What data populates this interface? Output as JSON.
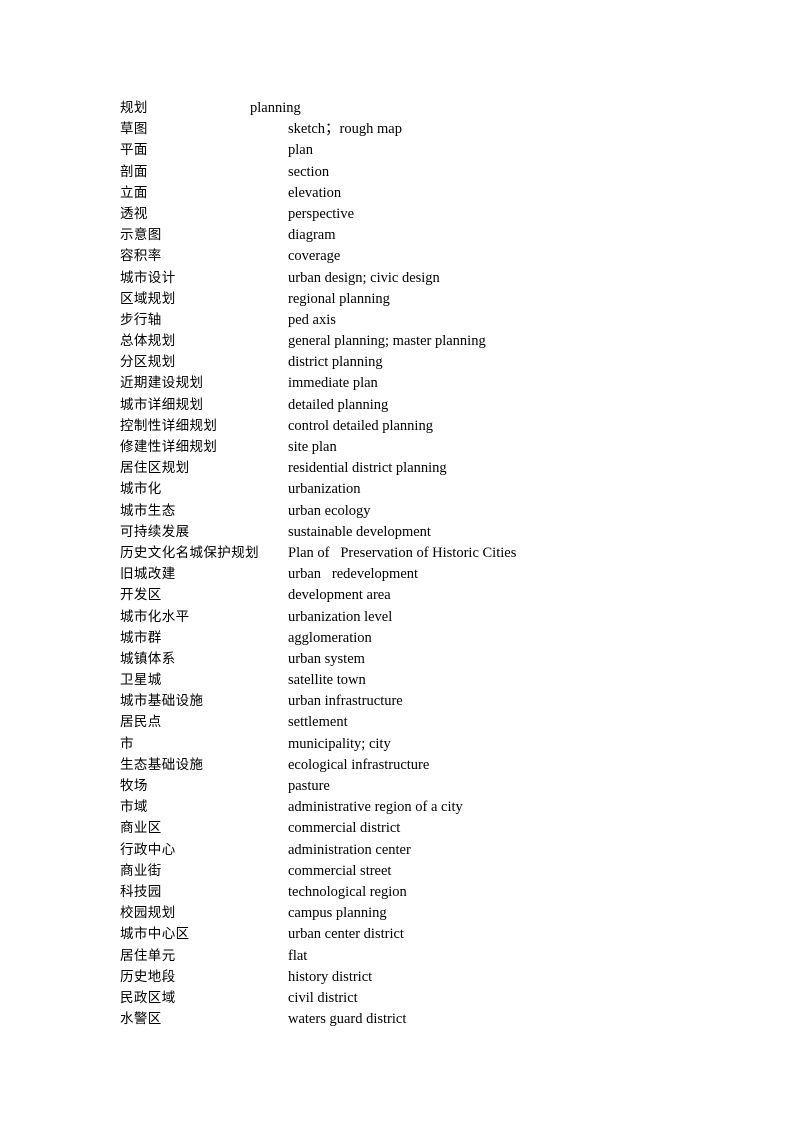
{
  "document": {
    "type": "glossary-list",
    "language_pair": "Chinese-English",
    "subject": "urban planning terminology",
    "background_color": "#ffffff",
    "text_color": "#000000"
  },
  "entries": [
    {
      "cn": "规划",
      "en": "planning",
      "short_indent": true
    },
    {
      "cn": "草图",
      "en": "sketch；rough map",
      "short_indent": false
    },
    {
      "cn": "平面",
      "en": "plan",
      "short_indent": false
    },
    {
      "cn": "剖面",
      "en": "section",
      "short_indent": false
    },
    {
      "cn": "立面",
      "en": "elevation",
      "short_indent": false
    },
    {
      "cn": "透视",
      "en": "perspective",
      "short_indent": false
    },
    {
      "cn": "示意图",
      "en": "diagram",
      "short_indent": false
    },
    {
      "cn": "容积率",
      "en": "coverage",
      "short_indent": false
    },
    {
      "cn": "城市设计",
      "en": "urban design; civic design",
      "short_indent": false
    },
    {
      "cn": "区域规划",
      "en": "regional planning",
      "short_indent": false
    },
    {
      "cn": "步行轴",
      "en": "ped axis",
      "short_indent": false
    },
    {
      "cn": "总体规划",
      "en": "general planning; master planning",
      "short_indent": false
    },
    {
      "cn": "分区规划",
      "en": "district planning",
      "short_indent": false
    },
    {
      "cn": "近期建设规划",
      "en": "immediate plan",
      "short_indent": false
    },
    {
      "cn": "城市详细规划",
      "en": "detailed planning",
      "short_indent": false
    },
    {
      "cn": "控制性详细规划",
      "en": "control detailed planning",
      "short_indent": false
    },
    {
      "cn": "修建性详细规划",
      "en": "site plan",
      "short_indent": false
    },
    {
      "cn": "居住区规划",
      "en": "residential district planning",
      "short_indent": false
    },
    {
      "cn": "城市化",
      "en": "urbanization",
      "short_indent": false
    },
    {
      "cn": "城市生态",
      "en": "urban ecology",
      "short_indent": false
    },
    {
      "cn": "可持续发展",
      "en": "sustainable development",
      "short_indent": false
    },
    {
      "cn": "历史文化名城保护规划",
      "en": "Plan of   Preservation of Historic Cities",
      "short_indent": false
    },
    {
      "cn": "旧城改建",
      "en": "urban   redevelopment",
      "short_indent": false
    },
    {
      "cn": "开发区",
      "en": "development area",
      "short_indent": false
    },
    {
      "cn": "城市化水平",
      "en": "urbanization level",
      "short_indent": false
    },
    {
      "cn": "城市群",
      "en": "agglomeration",
      "short_indent": false
    },
    {
      "cn": "城镇体系",
      "en": "urban system",
      "short_indent": false
    },
    {
      "cn": "卫星城",
      "en": "satellite town",
      "short_indent": false
    },
    {
      "cn": "城市基础设施",
      "en": "urban infrastructure",
      "short_indent": false
    },
    {
      "cn": "居民点",
      "en": "settlement",
      "short_indent": false
    },
    {
      "cn": "市",
      "en": "municipality; city",
      "short_indent": false
    },
    {
      "cn": "生态基础设施",
      "en": "ecological infrastructure",
      "short_indent": false
    },
    {
      "cn": "牧场",
      "en": "pasture",
      "short_indent": false
    },
    {
      "cn": "市域",
      "en": "administrative region of a city",
      "short_indent": false
    },
    {
      "cn": "商业区",
      "en": "commercial district",
      "short_indent": false
    },
    {
      "cn": "行政中心",
      "en": "administration center",
      "short_indent": false
    },
    {
      "cn": "商业街",
      "en": "commercial street",
      "short_indent": false
    },
    {
      "cn": "科技园",
      "en": "technological region",
      "short_indent": false
    },
    {
      "cn": "校园规划",
      "en": "campus planning",
      "short_indent": false
    },
    {
      "cn": "城市中心区",
      "en": "urban center district",
      "short_indent": false
    },
    {
      "cn": "居住单元",
      "en": "flat",
      "short_indent": false
    },
    {
      "cn": "历史地段",
      "en": "history district",
      "short_indent": false
    },
    {
      "cn": "民政区域",
      "en": "civil district",
      "short_indent": false
    },
    {
      "cn": "水警区",
      "en": "waters guard district",
      "short_indent": false
    }
  ]
}
